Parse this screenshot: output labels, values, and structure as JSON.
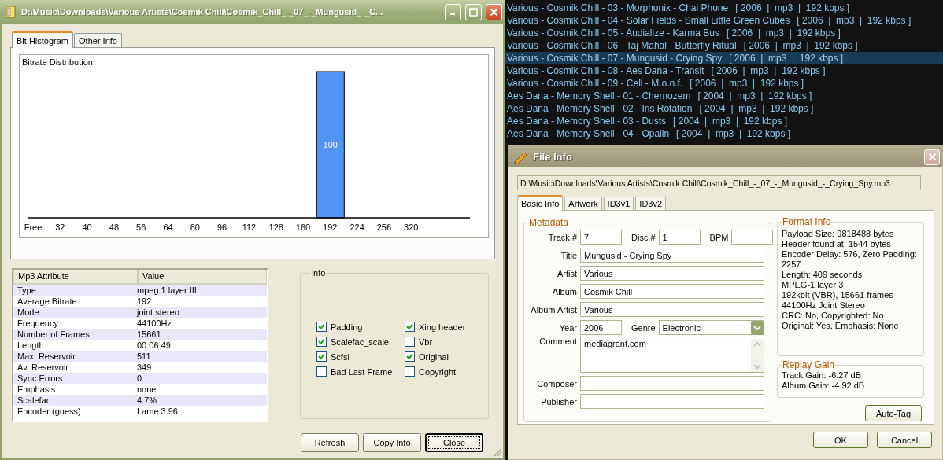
{
  "main_window": {
    "title": "D:\\Music\\Downloads\\Various Artists\\Cosmik Chill\\Cosmik_Chill_-_07_-_Mungusid_-_C...",
    "tabs": [
      {
        "label": "Bit Histogram",
        "selected": true
      },
      {
        "label": "Other Info",
        "selected": false
      }
    ],
    "histogram": {
      "title": "Bitrate Distribution",
      "chart_data": {
        "type": "bar",
        "categories": [
          "Free",
          "32",
          "40",
          "48",
          "56",
          "64",
          "80",
          "96",
          "112",
          "128",
          "160",
          "192",
          "224",
          "256",
          "320"
        ],
        "values": [
          0,
          0,
          0,
          0,
          0,
          0,
          0,
          0,
          0,
          0,
          0,
          100,
          0,
          0,
          0
        ],
        "value_labels": [
          null,
          null,
          null,
          null,
          null,
          null,
          null,
          null,
          null,
          null,
          null,
          "100",
          null,
          null,
          null
        ],
        "ylim": [
          0,
          100
        ]
      }
    },
    "attributes_table": {
      "columns": [
        "Mp3 Attribute",
        "Value"
      ],
      "rows": [
        {
          "attribute": "Type",
          "value": "mpeg 1 layer III"
        },
        {
          "attribute": "Average Bitrate",
          "value": "192"
        },
        {
          "attribute": "Mode",
          "value": "joint stereo"
        },
        {
          "attribute": "Frequency",
          "value": "44100Hz"
        },
        {
          "attribute": "Number of Frames",
          "value": "15661"
        },
        {
          "attribute": "Length",
          "value": "00:06:49"
        },
        {
          "attribute": "Max. Reservoir",
          "value": "511"
        },
        {
          "attribute": "Av. Reservoir",
          "value": "349"
        },
        {
          "attribute": "Sync Errors",
          "value": "0"
        },
        {
          "attribute": "Emphasis",
          "value": "none"
        },
        {
          "attribute": "Scalefac",
          "value": "4.7%"
        },
        {
          "attribute": "Encoder (guess)",
          "value": "Lame 3.96"
        }
      ]
    },
    "info_group": {
      "title": "Info",
      "flags": [
        {
          "label": "Padding",
          "checked": true
        },
        {
          "label": "Xing header",
          "checked": true
        },
        {
          "label": "Scalefac_scale",
          "checked": true
        },
        {
          "label": "Vbr",
          "checked": false
        },
        {
          "label": "Scfsi",
          "checked": true
        },
        {
          "label": "Original",
          "checked": true
        },
        {
          "label": "Bad Last Frame",
          "checked": false
        },
        {
          "label": "Copyright",
          "checked": false
        }
      ]
    },
    "buttons": [
      {
        "label": "Refresh",
        "default": false
      },
      {
        "label": "Copy Info",
        "default": false
      },
      {
        "label": "Close",
        "default": true
      }
    ]
  },
  "playlist": {
    "items": [
      {
        "name": "Various - Cosmik Chill - 03 - Morphonix - Chai Phone",
        "details": "[ 2006  |  mp3  |  192 kbps ]",
        "selected": false
      },
      {
        "name": "Various - Cosmik Chill - 04 - Solar Fields - Small Little Green Cubes",
        "details": "[ 2006  |  mp3  |  192 kbps ]",
        "selected": false
      },
      {
        "name": "Various - Cosmik Chill - 05 - Audialize - Karma Bus",
        "details": "[ 2006  |  mp3  |  192 kbps ]",
        "selected": false
      },
      {
        "name": "Various - Cosmik Chill - 06 - Taj Mahal - Butterfly Ritual",
        "details": "[ 2006  |  mp3  |  192 kbps ]",
        "selected": false
      },
      {
        "name": "Various - Cosmik Chill - 07 - Mungusid - Crying Spy",
        "details": "[ 2006  |  mp3  |  192 kbps ]",
        "selected": true
      },
      {
        "name": "Various - Cosmik Chill - 08 - Aes Dana - Transit",
        "details": "[ 2006  |  mp3  |  192 kbps ]",
        "selected": false
      },
      {
        "name": "Various - Cosmik Chill - 09 - Cell - M.o.o.f.",
        "details": "[ 2006  |  mp3  |  192 kbps ]",
        "selected": false
      },
      {
        "name": "Aes Dana - Memory Shell - 01 - Chernozem",
        "details": "[ 2004  |  mp3  |  192 kbps ]",
        "selected": false
      },
      {
        "name": "Aes Dana - Memory Shell - 02 - Iris Rotation",
        "details": "[ 2004  |  mp3  |  192 kbps ]",
        "selected": false
      },
      {
        "name": "Aes Dana - Memory Shell - 03 - Dusts",
        "details": "[ 2004  |  mp3  |  192 kbps ]",
        "selected": false
      },
      {
        "name": "Aes Dana - Memory Shell - 04 - Opalin",
        "details": "[ 2004  |  mp3  |  192 kbps ]",
        "selected": false
      }
    ]
  },
  "file_info_dialog": {
    "title": "File Info",
    "path": "D:\\Music\\Downloads\\Various Artists\\Cosmik Chill\\Cosmik_Chill_-_07_-_Mungusid_-_Crying_Spy.mp3",
    "tabs": [
      {
        "label": "Basic Info",
        "selected": true
      },
      {
        "label": "Artwork",
        "selected": false
      },
      {
        "label": "ID3v1",
        "selected": false
      },
      {
        "label": "ID3v2",
        "selected": false
      }
    ],
    "metadata": {
      "title": "Metadata",
      "rows": [
        [
          {
            "label": "Track #",
            "value": "7",
            "kind": "short"
          },
          {
            "label": "Disc #",
            "value": "1",
            "kind": "short"
          },
          {
            "label": "BPM",
            "kind": "short"
          }
        ],
        [
          {
            "label": "Title",
            "value": "Mungusid - Crying Spy",
            "kind": "text"
          }
        ],
        [
          {
            "label": "Artist",
            "value": "Various",
            "kind": "text"
          }
        ],
        [
          {
            "label": "Album",
            "value": "Cosmik Chill",
            "kind": "text"
          }
        ],
        [
          {
            "label": "Album Artist",
            "value": "Various",
            "kind": "text"
          }
        ],
        [
          {
            "label": "Year",
            "value": "2006",
            "kind": "short"
          },
          {
            "label": "Genre",
            "value": "Electronic",
            "kind": "select"
          }
        ],
        [
          {
            "label": "Comment",
            "value": "mediagrant.com",
            "kind": "textarea"
          }
        ],
        [
          {
            "label": "Composer",
            "kind": "text"
          }
        ],
        [
          {
            "label": "Publisher",
            "kind": "text"
          }
        ]
      ]
    },
    "format_info": {
      "title": "Format Info",
      "lines": [
        "Payload Size: 9818488 bytes",
        "Header found at: 1544 bytes",
        "Encoder Delay: 576, Zero Padding: 2257",
        "Length: 409 seconds",
        "MPEG-1 layer 3",
        "192kbit (VBR), 15661 frames",
        "44100Hz Joint Stereo",
        "CRC: No, Copyrighted: No",
        "Original: Yes, Emphasis: None"
      ]
    },
    "replay_gain": {
      "title": "Replay Gain",
      "lines": [
        "Track Gain: -6.27 dB",
        "Album Gain: -4.92 dB"
      ]
    },
    "auto_tag_button": "Auto-Tag",
    "buttons": [
      "OK",
      "Cancel"
    ]
  }
}
